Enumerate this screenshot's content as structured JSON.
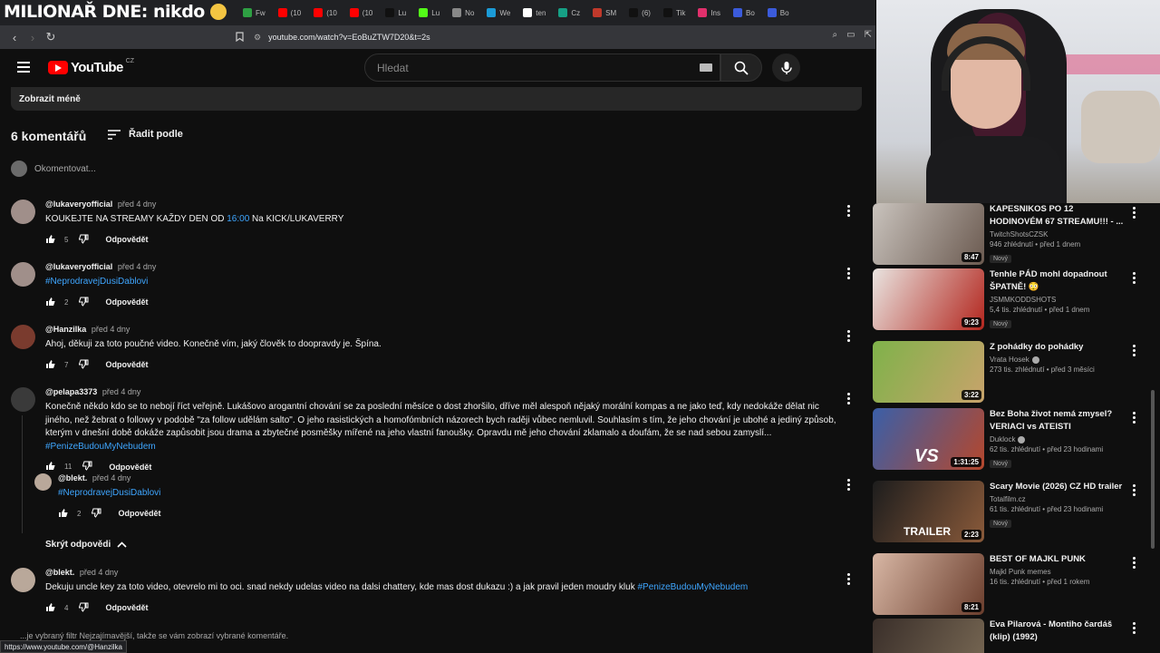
{
  "overlay": {
    "title": "MILIONAŘ DNE: nikdo"
  },
  "browser": {
    "tabs": [
      {
        "label": "Fw",
        "color": "#2ea043"
      },
      {
        "label": "(10",
        "color": "#ff0000"
      },
      {
        "label": "(10",
        "color": "#ff0000"
      },
      {
        "label": "(10",
        "color": "#ff0000"
      },
      {
        "label": "Lu",
        "color": "#111111"
      },
      {
        "label": "Lu",
        "color": "#53fc18"
      },
      {
        "label": "No",
        "color": "#888888"
      },
      {
        "label": "We",
        "color": "#1b9bd7"
      },
      {
        "label": "ten",
        "color": "#ffffff"
      },
      {
        "label": "Cz",
        "color": "#16a085"
      },
      {
        "label": "SM",
        "color": "#c0392b"
      },
      {
        "label": "(6)",
        "color": "#111111"
      },
      {
        "label": "Tik",
        "color": "#111111"
      },
      {
        "label": "Ins",
        "color": "#e1306c"
      },
      {
        "label": "Bo",
        "color": "#3b5bdb"
      },
      {
        "label": "Bo",
        "color": "#3b5bdb"
      }
    ],
    "url": "youtube.com/watch?v=EoBuZTW7D20&t=2s"
  },
  "yt": {
    "logo_text": "YouTube",
    "region": "CZ",
    "search_placeholder": "Hledat"
  },
  "show_less": "Zobrazit méně",
  "comments_header": {
    "count": "6 komentářů",
    "sort": "Řadit podle",
    "add_placeholder": "Okomentovat..."
  },
  "comments": [
    {
      "author": "@lukaveryofficial",
      "time": "před 4 dny",
      "text_a": "KOUKEJTE NA STREAMY KAŽDY DEN OD ",
      "link": "16:00",
      "text_b": " Na KICK/LUKAVERRY",
      "likes": "5",
      "reply": "Odpovědět",
      "avatar_color": "#a08f8a"
    },
    {
      "author": "@lukaveryofficial",
      "time": "před 4 dny",
      "text_a": "",
      "link": "#NeprodravejDusiDablovi",
      "text_b": "",
      "likes": "2",
      "reply": "Odpovědět",
      "avatar_color": "#a08f8a"
    },
    {
      "author": "@Hanzilka",
      "time": "před 4 dny",
      "text_a": "Ahoj, děkuji za toto poučné video. Konečně vím, jaký člověk to doopravdy je. Špína.",
      "link": "",
      "text_b": "",
      "likes": "7",
      "reply": "Odpovědět",
      "avatar_color": "#7a3b2e"
    },
    {
      "author": "@pelapa3373",
      "time": "před 4 dny",
      "text_a": "Konečně někdo kdo se to nebojí říct veřejně. Lukášovo arogantní chování se za poslední měsíce o dost zhoršilo, dříve měl alespoň nějaký morální kompas a ne jako teď, kdy nedokáže dělat nic jiného, než žebrat o followy v podobě \"za follow udělám salto\". O jeho rasistických a homofómbních názorech bych raději vůbec nemluvil. Souhlasím s tím, že jeho chování je ubohé a jediný způsob, kterým v dnešní době dokáže zapůsobit jsou drama a zbytečné posměšky mířené na jeho vlastní fanoušky. Opravdu mě jeho chování zklamalo a doufám, že se nad sebou zamyslí... ",
      "link": "#PenizeBudouMyNebudem",
      "text_b": "",
      "likes": "11",
      "reply": "Odpovědět",
      "avatar_color": "#3a3a3a"
    },
    {
      "author": "@blekt.",
      "time": "před 4 dny",
      "text_a": "",
      "link": "#NeprodravejDusiDablovi",
      "text_b": "",
      "likes": "2",
      "reply": "Odpovědět",
      "avatar_color": "#b9a89a"
    },
    {
      "author": "@blekt.",
      "time": "před 4 dny",
      "text_a": "Dekuju uncle key za toto video, otevrelo mi to oci. snad nekdy udelas video na dalsi chattery, kde mas dost dukazu :) a jak pravil jeden moudry kluk ",
      "link": "#PenizeBudouMyNebudem",
      "text_b": "",
      "likes": "4",
      "reply": "Odpovědět",
      "avatar_color": "#b9a89a"
    }
  ],
  "hide_replies": "Skrýt odpovědi",
  "footer_note": "...je vybraný filtr Nejzajímavější, takže se vám zobrazí vybrané komentáře.",
  "status_url": "https://www.youtube.com/@Hanzilka",
  "recommended": [
    {
      "title": "KAPESNIKOS PO 12 HODINOVÉM 67 STREAMU!!! - ...",
      "channel": "TwitchShotsCZSK",
      "verified": false,
      "meta": "946 zhlédnutí • před 1 dnem",
      "badge": "Nový",
      "duration": "8:47",
      "thumb_a": "#c9c3bd",
      "thumb_b": "#6b5a50"
    },
    {
      "title": "Tenhle PÁD mohl dopadnout ŠPATNĚ! 😳",
      "channel": "JSMMKODDSHOTS",
      "verified": false,
      "meta": "5,4 tis. zhlédnutí • před 1 dnem",
      "badge": "Nový",
      "duration": "9:23",
      "thumb_a": "#e9e4e0",
      "thumb_b": "#b3261e"
    },
    {
      "title": "Z pohádky do pohádky",
      "channel": "Vrata Hosek",
      "verified": true,
      "meta": "273 tis. zhlédnutí • před 3 měsíci",
      "badge": "",
      "duration": "3:22",
      "thumb_a": "#7fb24a",
      "thumb_b": "#c8a36b"
    },
    {
      "title": "Bez Boha život nemá zmysel? VERIACI vs ATEISTI",
      "channel": "Duklock",
      "verified": true,
      "meta": "62 tis. zhlédnutí • před 23 hodinami",
      "badge": "Nový",
      "duration": "1:31:25",
      "thumb_a": "#3a5fa8",
      "thumb_b": "#b5472c"
    },
    {
      "title": "Scary Movie (2026) CZ HD trailer",
      "channel": "Totalfilm.cz",
      "verified": false,
      "meta": "61 tis. zhlédnutí • před 23 hodinami",
      "badge": "Nový",
      "duration": "2:23",
      "thumb_a": "#1d1d1d",
      "thumb_b": "#8a5a3a"
    },
    {
      "title": "BEST OF MAJKL PUNK",
      "channel": "Majkl Punk memes",
      "verified": false,
      "meta": "16 tis. zhlédnutí • před 1 rokem",
      "badge": "",
      "duration": "8:21",
      "thumb_a": "#d8b7a5",
      "thumb_b": "#6a3d2c"
    },
    {
      "title": "Eva Pilarová - Montiho čardáš (klip) (1992)",
      "channel": "",
      "verified": false,
      "meta": "",
      "badge": "",
      "duration": "",
      "thumb_a": "#3a2f2a",
      "thumb_b": "#7a6a55"
    }
  ],
  "thumb_texts": {
    "trailer": "TRAILER",
    "vs": "VS"
  }
}
